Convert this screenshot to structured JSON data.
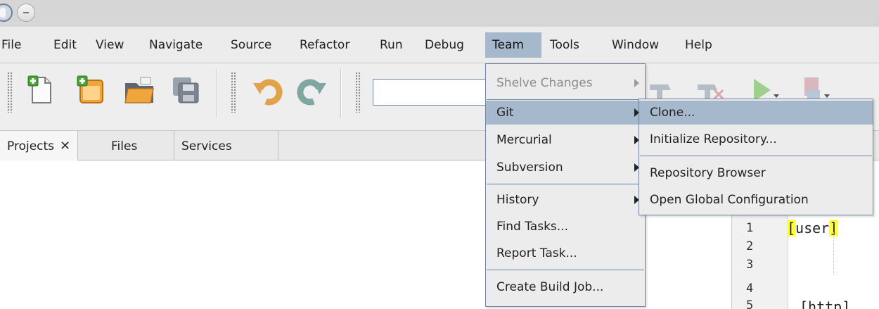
{
  "menubar": {
    "items": [
      "File",
      "Edit",
      "View",
      "Navigate",
      "Source",
      "Refactor",
      "Run",
      "Debug",
      "Team",
      "Tools",
      "Window",
      "Help"
    ]
  },
  "toolbar": {
    "icons": [
      "new-file-icon",
      "new-project-icon",
      "open-project-icon",
      "save-all-icon",
      "undo-icon",
      "redo-icon",
      "hammer-icon",
      "clean-build-icon",
      "run-icon",
      "profile-icon"
    ]
  },
  "panel_tabs": {
    "projects": "Projects",
    "close": "✕",
    "files": "Files",
    "services": "Services"
  },
  "team_menu": {
    "items": [
      "Shelve Changes",
      "Git",
      "Mercurial",
      "Subversion",
      "History",
      "Find Tasks...",
      "Report Task...",
      "Create Build Job..."
    ]
  },
  "git_menu": {
    "items": [
      "Clone...",
      "Initialize Repository...",
      "Repository Browser",
      "Open Global Configuration"
    ]
  },
  "editor": {
    "line_numbers": [
      "1",
      "2",
      "3",
      "4",
      "5"
    ],
    "line1_open": "[",
    "line1_word": "user",
    "line1_close": "]",
    "line5_text": "[http]"
  },
  "colors": {
    "menu_highlight": "#a6b8cc",
    "menu_border": "#6d85a3",
    "bracket_highlight": "#ffff3a"
  }
}
